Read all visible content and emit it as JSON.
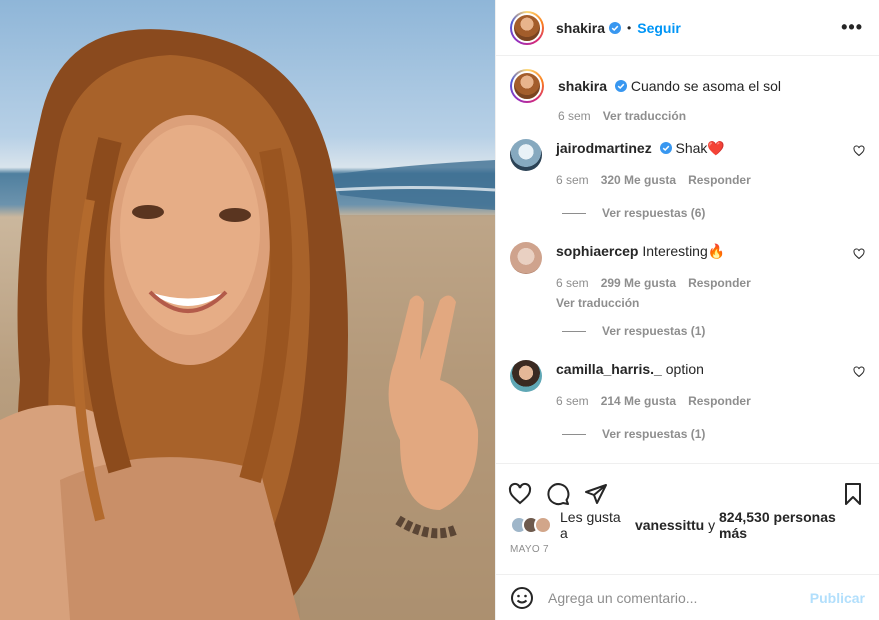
{
  "post": {
    "author": "shakira",
    "follow_label": "Seguir",
    "separator": "•",
    "more_label": "•••",
    "caption": "Cuando se asoma el sol",
    "caption_time": "6 sem",
    "translate_label": "Ver traducción"
  },
  "comments": [
    {
      "user": "jairodmartinez",
      "verified": true,
      "text": "Shak❤️",
      "time": "6 sem",
      "likes": "320 Me gusta",
      "reply": "Responder",
      "view_replies": "Ver respuestas (6)"
    },
    {
      "user": "sophiaercep",
      "verified": false,
      "text": "Interesting🔥",
      "time": "6 sem",
      "likes": "299 Me gusta",
      "reply": "Responder",
      "translate": "Ver traducción",
      "view_replies": "Ver respuestas (1)"
    },
    {
      "user": "camilla_harris._",
      "verified": false,
      "text": "option",
      "time": "6 sem",
      "likes": "214 Me gusta",
      "reply": "Responder",
      "view_replies": "Ver respuestas (1)"
    }
  ],
  "likes": {
    "prefix": "Les gusta a",
    "user": "vanessittu",
    "joiner": "y",
    "others": "824,530 personas más"
  },
  "date": "MAYO 7",
  "add_comment": {
    "placeholder": "Agrega un comentario...",
    "publish_label": "Publicar"
  },
  "colors": {
    "accent": "#0095f6",
    "verified": "#3897f0",
    "heart": "#ed4956",
    "muted": "#8e8e8e"
  },
  "icons": [
    "heart-icon",
    "comment-icon",
    "share-icon",
    "bookmark-icon",
    "emoji-icon",
    "verified-icon"
  ]
}
